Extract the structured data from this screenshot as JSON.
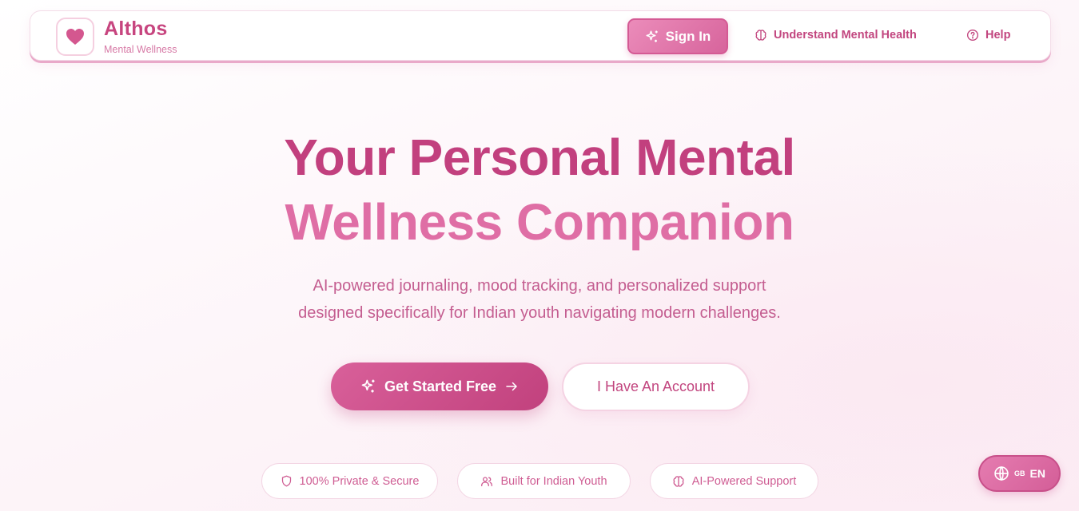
{
  "brand": {
    "name": "Althos",
    "tagline": "Mental Wellness"
  },
  "nav": {
    "sign_in": "Sign In",
    "understand": "Understand Mental Health",
    "help": "Help"
  },
  "hero": {
    "title_line1": "Your Personal Mental",
    "title_line2": "Wellness Companion",
    "subtitle_line1": "AI-powered journaling, mood tracking, and personalized support",
    "subtitle_line2": "designed specifically for Indian youth navigating modern challenges.",
    "cta_primary": "Get Started Free",
    "cta_secondary": "I Have An Account"
  },
  "features": [
    {
      "label": "100% Private & Secure",
      "icon": "shield-icon"
    },
    {
      "label": "Built for Indian Youth",
      "icon": "users-icon"
    },
    {
      "label": "AI-Powered Support",
      "icon": "brain-icon"
    }
  ],
  "language": {
    "flag": "GB",
    "code": "EN"
  },
  "colors": {
    "primary": "#c2467f",
    "accent": "#df6ea5",
    "button_gradient_start": "#d9609a",
    "button_gradient_end": "#c1417d"
  }
}
